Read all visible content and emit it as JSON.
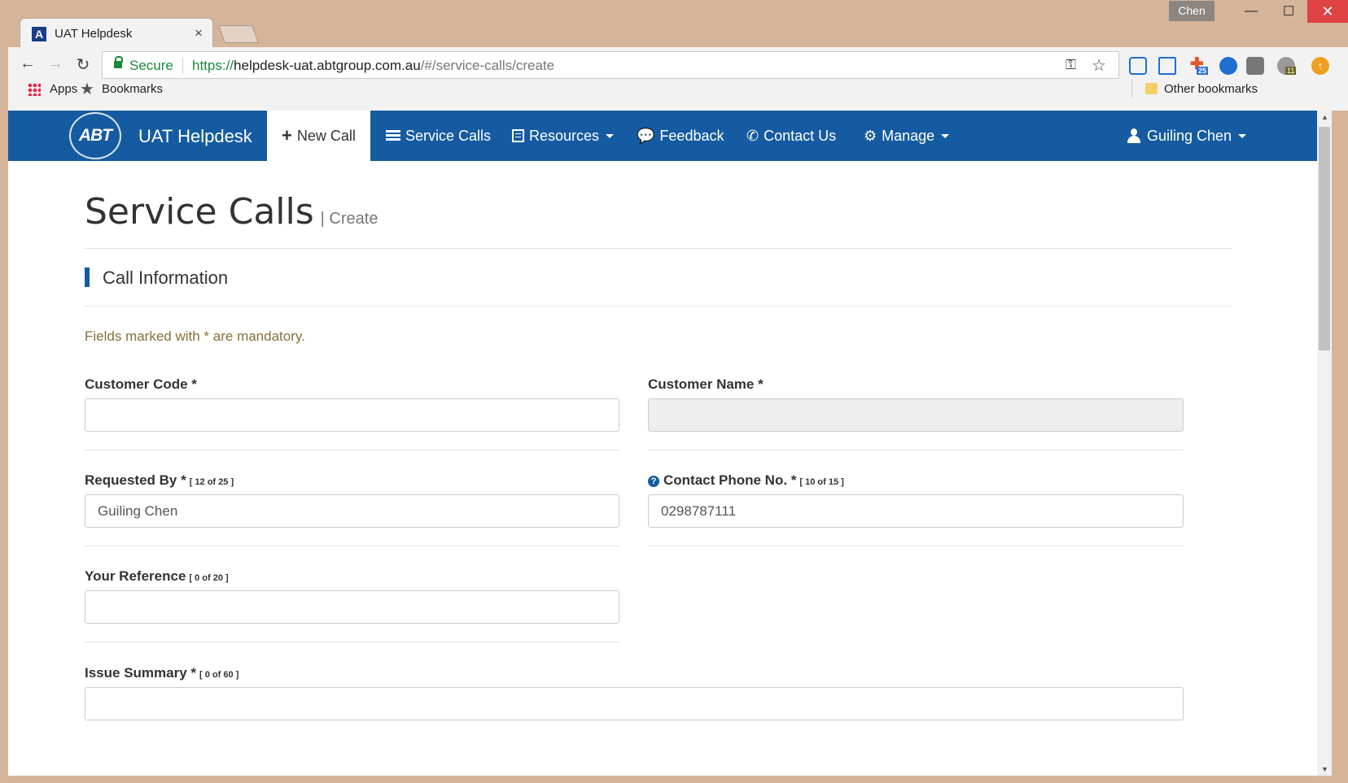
{
  "window": {
    "profile": "Chen",
    "minimize_icon": "—",
    "maximize_icon": "☐",
    "close_icon": "✕"
  },
  "tab": {
    "title": "UAT Helpdesk",
    "favicon_letter": "A",
    "close_icon": "×"
  },
  "toolbar": {
    "back_icon": "←",
    "forward_icon": "→",
    "reload_icon": "↻",
    "secure_label": "Secure",
    "url_protocol": "https://",
    "url_host": "helpdesk-uat.abtgroup.com.au",
    "url_path": "/#/service-calls/create",
    "key_icon": "⚿",
    "star_icon": "☆",
    "ext_badge_1": "25",
    "ext_badge_2": "11",
    "ext_update_icon": "↑"
  },
  "bookmarks": {
    "apps": "Apps",
    "star_icon": "★",
    "bookmarks": "Bookmarks",
    "other": "Other bookmarks"
  },
  "navbar": {
    "logo_text": "ABT",
    "brand": "UAT Helpdesk",
    "items": [
      {
        "label": "New Call",
        "icon": "+"
      },
      {
        "label": "Service Calls"
      },
      {
        "label": "Resources"
      },
      {
        "label": "Feedback",
        "icon": "💬"
      },
      {
        "label": "Contact Us",
        "icon": "✆"
      },
      {
        "label": "Manage",
        "icon": "⚙"
      }
    ],
    "user": "Guiling Chen"
  },
  "page": {
    "title": "Service Calls",
    "subtitle": "| Create",
    "section_title": "Call Information",
    "mandatory_note": "Fields marked with * are mandatory."
  },
  "form": {
    "customer_code": {
      "label": "Customer Code *",
      "value": ""
    },
    "customer_name": {
      "label": "Customer Name *",
      "value": ""
    },
    "requested_by": {
      "label": "Requested By *",
      "counter": "[ 12 of 25 ]",
      "value": "Guiling Chen"
    },
    "contact_phone": {
      "label": "Contact Phone No. *",
      "counter": "[ 10 of 15 ]",
      "value": "0298787111",
      "help_icon": "?"
    },
    "your_reference": {
      "label": "Your Reference",
      "counter": "[ 0 of 20 ]",
      "value": ""
    },
    "issue_summary": {
      "label": "Issue Summary *",
      "counter": "[ 0 of 60 ]",
      "value": ""
    }
  },
  "scrollbar": {
    "up_icon": "▲",
    "down_icon": "▼"
  }
}
